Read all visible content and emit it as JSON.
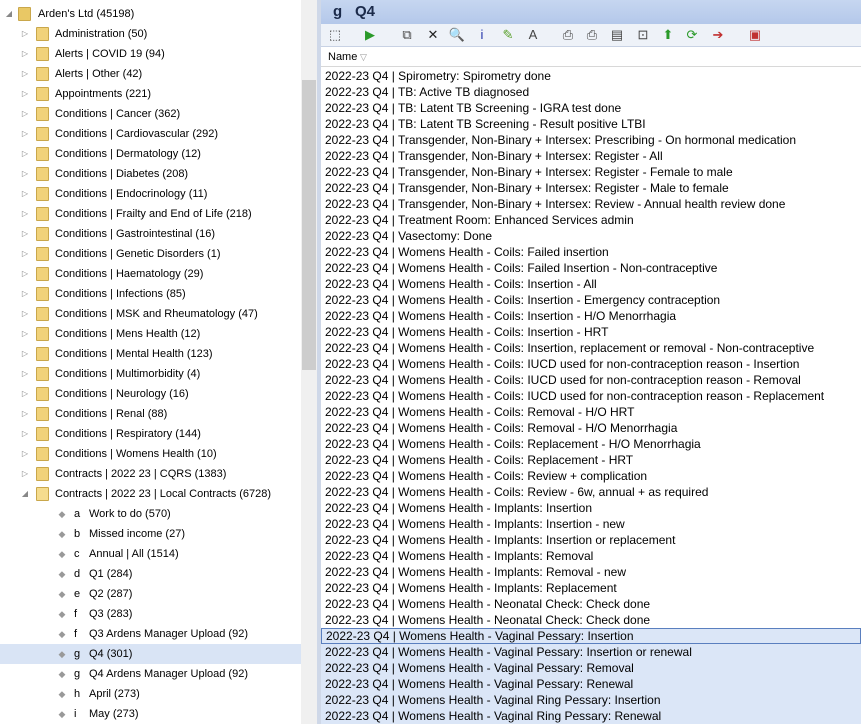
{
  "tree": {
    "root": "Arden's Ltd (45198)",
    "folders": [
      "Administration (50)",
      "Alerts | COVID 19 (94)",
      "Alerts | Other (42)",
      "Appointments (221)",
      "Conditions | Cancer (362)",
      "Conditions | Cardiovascular (292)",
      "Conditions | Dermatology (12)",
      "Conditions | Diabetes (208)",
      "Conditions | Endocrinology (11)",
      "Conditions | Frailty and End of Life (218)",
      "Conditions | Gastrointestinal (16)",
      "Conditions | Genetic Disorders (1)",
      "Conditions | Haematology (29)",
      "Conditions | Infections (85)",
      "Conditions | MSK and Rheumatology (47)",
      "Conditions | Mens Health (12)",
      "Conditions | Mental Health (123)",
      "Conditions | Multimorbidity (4)",
      "Conditions | Neurology (16)",
      "Conditions | Renal (88)",
      "Conditions | Respiratory (144)",
      "Conditions | Womens Health (10)",
      "Contracts | 2022 23 | CQRS (1383)"
    ],
    "open_folder": "Contracts | 2022 23 | Local Contracts (6728)",
    "children": [
      {
        "code": "a",
        "label": "Work to do (570)"
      },
      {
        "code": "b",
        "label": "Missed  income (27)"
      },
      {
        "code": "c",
        "label": "Annual | All (1514)"
      },
      {
        "code": "d",
        "label": "Q1 (284)"
      },
      {
        "code": "e",
        "label": "Q2 (287)"
      },
      {
        "code": "f",
        "label": "Q3 (283)"
      },
      {
        "code": "f",
        "label": "Q3 Ardens Manager Upload (92)"
      },
      {
        "code": "g",
        "label": "Q4 (301)",
        "selected": true
      },
      {
        "code": "g",
        "label": "Q4 Ardens Manager Upload (92)"
      },
      {
        "code": "h",
        "label": "April (273)"
      },
      {
        "code": "i",
        "label": "May (273)"
      }
    ]
  },
  "pane": {
    "title_code": "g",
    "title": "Q4",
    "column_header": "Name",
    "toolbar_icons": [
      "select-icon",
      "run-icon",
      "copy-icon",
      "delete-icon",
      "find-icon",
      "info-icon",
      "edit-icon",
      "font-icon",
      "print-icon",
      "print-all-icon",
      "report-icon",
      "export-icon",
      "move-up-icon",
      "refresh-icon",
      "forward-icon",
      "book-icon"
    ],
    "rows": [
      "2022-23 Q4 | Spirometry: Spirometry done",
      "2022-23 Q4 | TB: Active TB diagnosed",
      "2022-23 Q4 | TB: Latent TB Screening - IGRA test done",
      "2022-23 Q4 | TB: Latent TB Screening - Result positive LTBI",
      "2022-23 Q4 | Transgender, Non-Binary + Intersex: Prescribing - On hormonal medication",
      "2022-23 Q4 | Transgender, Non-Binary + Intersex: Register - All",
      "2022-23 Q4 | Transgender, Non-Binary + Intersex: Register - Female to male",
      "2022-23 Q4 | Transgender, Non-Binary + Intersex: Register - Male to female",
      "2022-23 Q4 | Transgender, Non-Binary + Intersex: Review - Annual health review done",
      "2022-23 Q4 | Treatment Room: Enhanced Services admin",
      "2022-23 Q4 | Vasectomy: Done",
      "2022-23 Q4 | Womens Health - Coils: Failed insertion",
      "2022-23 Q4 | Womens Health - Coils: Failed Insertion - Non-contraceptive",
      "2022-23 Q4 | Womens Health - Coils: Insertion - All",
      "2022-23 Q4 | Womens Health - Coils: Insertion - Emergency contraception",
      "2022-23 Q4 | Womens Health - Coils: Insertion - H/O Menorrhagia",
      "2022-23 Q4 | Womens Health - Coils: Insertion - HRT",
      "2022-23 Q4 | Womens Health - Coils: Insertion, replacement or removal - Non-contraceptive",
      "2022-23 Q4 | Womens Health - Coils: IUCD used for non-contraception reason - Insertion",
      "2022-23 Q4 | Womens Health - Coils: IUCD used for non-contraception reason - Removal",
      "2022-23 Q4 | Womens Health - Coils: IUCD used for non-contraception reason - Replacement",
      "2022-23 Q4 | Womens Health - Coils: Removal - H/O HRT",
      "2022-23 Q4 | Womens Health - Coils: Removal - H/O Menorrhagia",
      "2022-23 Q4 | Womens Health - Coils: Replacement - H/O Menorrhagia",
      "2022-23 Q4 | Womens Health - Coils: Replacement - HRT",
      "2022-23 Q4 | Womens Health - Coils: Review + complication",
      "2022-23 Q4 | Womens Health - Coils: Review - 6w, annual + as required",
      "2022-23 Q4 | Womens Health - Implants: Insertion",
      "2022-23 Q4 | Womens Health - Implants: Insertion - new",
      "2022-23 Q4 | Womens Health - Implants: Insertion or replacement",
      "2022-23 Q4 | Womens Health - Implants: Removal",
      "2022-23 Q4 | Womens Health - Implants: Removal - new",
      "2022-23 Q4 | Womens Health - Implants: Replacement",
      "2022-23 Q4 | Womens Health - Neonatal Check: Check done",
      "2022-23 Q4 | Womens Health - Neonatal Check: Check done",
      "2022-23 Q4 | Womens Health - Vaginal Pessary: Insertion",
      "2022-23 Q4 | Womens Health - Vaginal Pessary: Insertion or renewal",
      "2022-23 Q4 | Womens Health - Vaginal Pessary: Removal",
      "2022-23 Q4 | Womens Health - Vaginal Pessary: Renewal",
      "2022-23 Q4 | Womens Health - Vaginal Ring Pessary: Insertion",
      "2022-23 Q4 | Womens Health - Vaginal Ring Pessary: Renewal"
    ],
    "focused_row": 35,
    "selected_from": 35
  }
}
